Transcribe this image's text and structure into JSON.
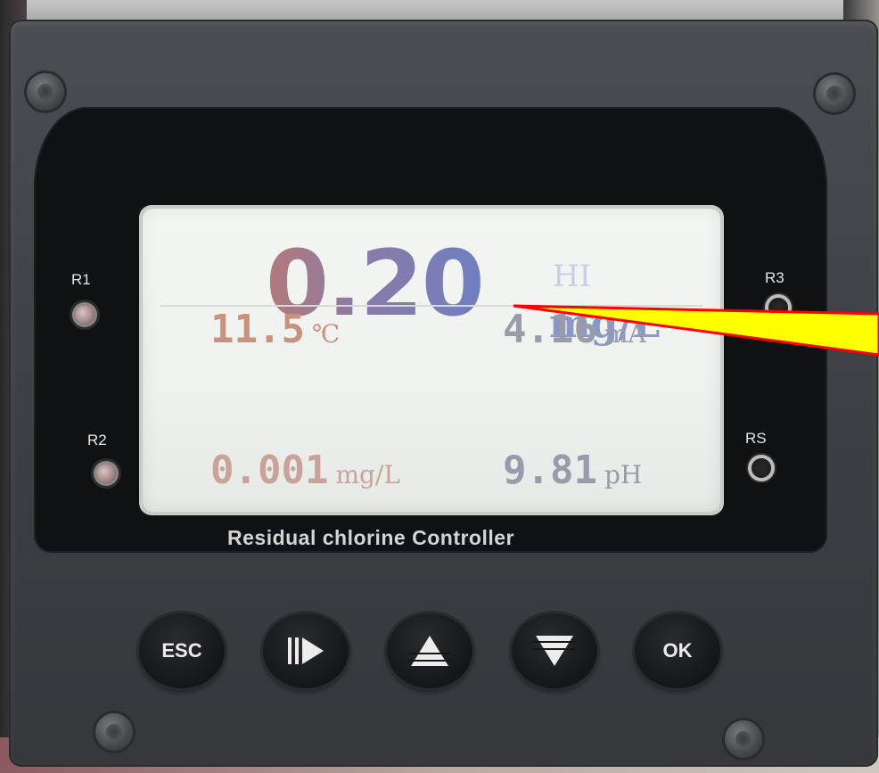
{
  "device": {
    "title": "Residual chlorine Controller"
  },
  "display": {
    "main_value": "0.20",
    "alarm_tag": "HI",
    "main_unit": "mg/L",
    "temperature": {
      "value": "11.5",
      "unit": "℃"
    },
    "current": {
      "value": "4.16",
      "unit": "mA"
    },
    "secondary_chlorine": {
      "value": "0.001",
      "unit": "mg/L"
    },
    "ph": {
      "value": "9.81",
      "unit": "pH"
    }
  },
  "relays": {
    "r1": "R1",
    "r2": "R2",
    "r3": "R3",
    "rs": "RS"
  },
  "buttons": {
    "esc": "ESC",
    "next_icon": "fast-forward-icon",
    "up_icon": "up-triangle-icon",
    "down_icon": "down-triangle-icon",
    "ok": "OK"
  },
  "colors": {
    "pointer_fill": "#ffff00",
    "pointer_stroke": "#ff0000"
  }
}
